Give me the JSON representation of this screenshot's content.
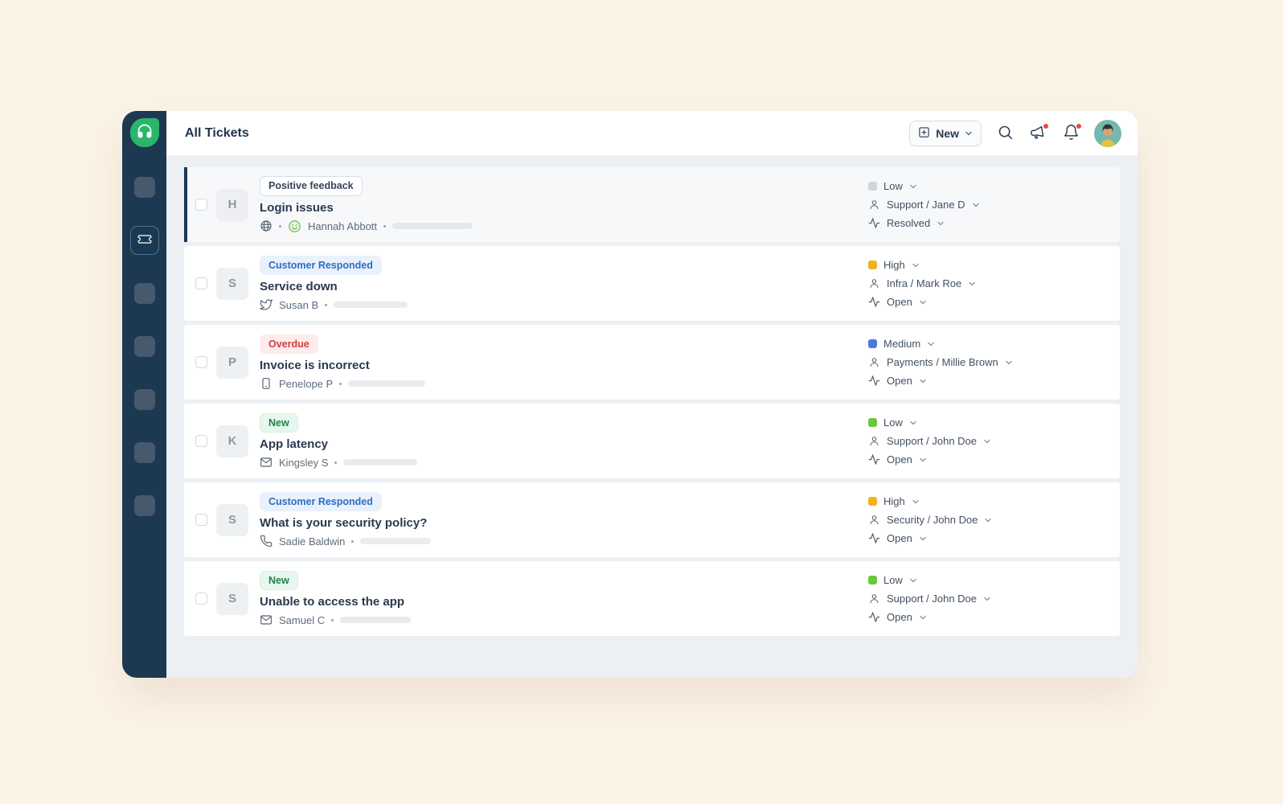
{
  "header": {
    "title": "All Tickets",
    "new_button_label": "New",
    "icons": [
      "plus-square-icon",
      "chevron-down-icon",
      "search-icon",
      "announcements-icon",
      "notifications-bell-icon",
      "user-avatar"
    ]
  },
  "sidebar": {
    "logo_icon": "headset-logo",
    "active_item": "tickets",
    "active_icon": "ticket-icon",
    "placeholder_items": 6,
    "colors": {
      "background": "#1c3951",
      "logo_green": "#2bb56b"
    }
  },
  "colors": {
    "page_background": "#fcf3e7",
    "content_background": "#eceff3",
    "priority_low_green": "#6bc83e",
    "priority_medium_blue": "#4a79e0",
    "priority_high_yellow": "#f3b21b",
    "priority_muted_gray": "#cfd5db",
    "badge_info_blue": "#2e6dc1",
    "badge_danger_red": "#d53b42",
    "badge_success_green": "#24824b",
    "notification_dot_red": "#e5484d"
  },
  "tickets": [
    {
      "avatar_letter": "H",
      "badge": {
        "label": "Positive feedback",
        "type": "neutral"
      },
      "title": "Login issues",
      "source_icon": "globe-icon",
      "csat_icon": "smiley-happy-icon",
      "requester": "Hannah Abbott",
      "priority": {
        "label": "Low",
        "color": "#cfd5db"
      },
      "group_agent": "Support / Jane D",
      "status": "Resolved",
      "selected": true
    },
    {
      "avatar_letter": "S",
      "badge": {
        "label": "Customer Responded",
        "type": "info"
      },
      "title": "Service down",
      "source_icon": "twitter-icon",
      "requester": "Susan B",
      "priority": {
        "label": "High",
        "color": "#f3b21b"
      },
      "group_agent": "Infra / Mark Roe",
      "status": "Open",
      "selected": false
    },
    {
      "avatar_letter": "P",
      "badge": {
        "label": "Overdue",
        "type": "danger"
      },
      "title": "Invoice is incorrect",
      "source_icon": "smartphone-icon",
      "requester": "Penelope P",
      "priority": {
        "label": "Medium",
        "color": "#4a79e0"
      },
      "group_agent": "Payments / Millie Brown",
      "status": "Open",
      "selected": false
    },
    {
      "avatar_letter": "K",
      "badge": {
        "label": "New",
        "type": "success"
      },
      "title": "App latency",
      "source_icon": "mail-icon",
      "requester": "Kingsley S",
      "priority": {
        "label": "Low",
        "color": "#6bc83e"
      },
      "group_agent": "Support / John Doe",
      "status": "Open",
      "selected": false
    },
    {
      "avatar_letter": "S",
      "badge": {
        "label": "Customer Responded",
        "type": "info"
      },
      "title": "What is your security policy?",
      "source_icon": "phone-icon",
      "requester": "Sadie Baldwin",
      "priority": {
        "label": "High",
        "color": "#f3b21b"
      },
      "group_agent": "Security / John Doe",
      "status": "Open",
      "selected": false
    },
    {
      "avatar_letter": "S",
      "badge": {
        "label": "New",
        "type": "success"
      },
      "title": "Unable to access the app",
      "source_icon": "mail-icon",
      "requester": "Samuel C",
      "priority": {
        "label": "Low",
        "color": "#6bc83e"
      },
      "group_agent": "Support / John Doe",
      "status": "Open",
      "selected": false
    }
  ]
}
